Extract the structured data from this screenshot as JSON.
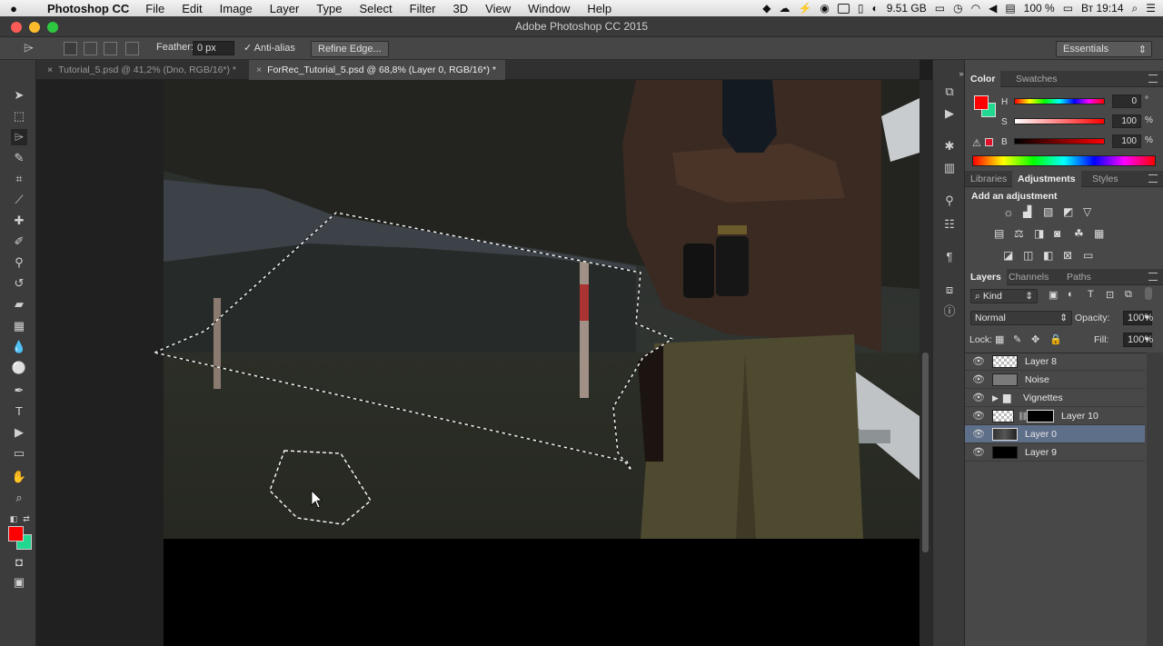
{
  "menubar": {
    "app": "Photoshop CC",
    "menus": [
      "File",
      "Edit",
      "Image",
      "Layer",
      "Type",
      "Select",
      "Filter",
      "3D",
      "View",
      "Window",
      "Help"
    ],
    "storage": "9.51 GB",
    "battery": "100 %",
    "clock": "Вт 19:14"
  },
  "window": {
    "title": "Adobe Photoshop CC 2015"
  },
  "options": {
    "feather_label": "Feather:",
    "feather_value": "0 px",
    "antialias_label": "Anti-alias",
    "refine_label": "Refine Edge...",
    "workspace": "Essentials"
  },
  "tabs": [
    {
      "label": "Tutorial_5.psd @ 41,2% (Dno, RGB/16*) *"
    },
    {
      "label": "ForRec_Tutorial_5.psd @ 68,8% (Layer 0, RGB/16*) *"
    }
  ],
  "color_panel": {
    "tabs": [
      "Color",
      "Swatches"
    ],
    "h_label": "H",
    "s_label": "S",
    "b_label": "B",
    "h_value": "0",
    "s_value": "100",
    "b_value": "100",
    "h_unit": "°",
    "s_unit": "%",
    "b_unit": "%",
    "foreground": "#ff0000",
    "background": "#22d890"
  },
  "adjust_panel": {
    "tabs": [
      "Libraries",
      "Adjustments",
      "Styles"
    ],
    "heading": "Add an adjustment"
  },
  "layers_panel": {
    "tabs": [
      "Layers",
      "Channels",
      "Paths"
    ],
    "filter_kind": "Kind",
    "blend_mode": "Normal",
    "opacity_label": "Opacity:",
    "opacity_value": "100%",
    "lock_label": "Lock:",
    "fill_label": "Fill:",
    "fill_value": "100%",
    "layers": [
      {
        "name": "Layer 8",
        "selected": false,
        "thumb": "checker"
      },
      {
        "name": "Noise",
        "selected": false,
        "thumb": "gray"
      },
      {
        "name": "Vignettes",
        "selected": false,
        "thumb": "folder"
      },
      {
        "name": "Layer 10",
        "selected": false,
        "thumb": "mask"
      },
      {
        "name": "Layer 0",
        "selected": true,
        "thumb": "photo"
      },
      {
        "name": "Layer 9",
        "selected": false,
        "thumb": "black"
      }
    ]
  }
}
